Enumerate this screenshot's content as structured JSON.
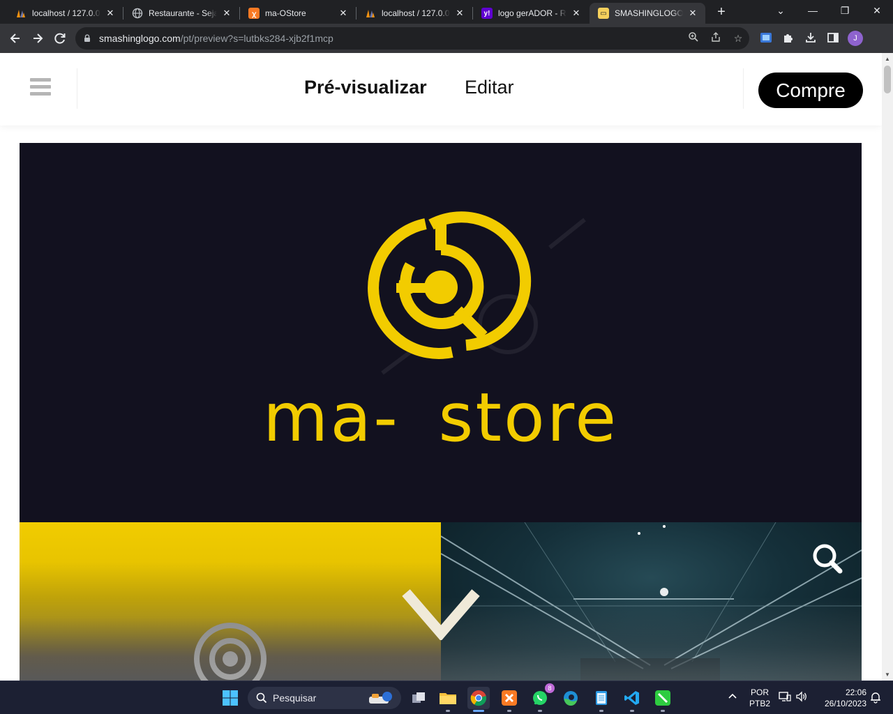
{
  "browser": {
    "tabs": [
      {
        "title": "localhost / 127.0.0.",
        "icon": "phpmyadmin-icon",
        "active": false
      },
      {
        "title": "Restaurante - Seja",
        "icon": "globe-icon",
        "active": false
      },
      {
        "title": "ma-OStore",
        "icon": "xampp-icon",
        "active": false
      },
      {
        "title": "localhost / 127.0.0.",
        "icon": "phpmyadmin-icon",
        "active": false
      },
      {
        "title": "logo gerADOR - Re",
        "icon": "yahoo-icon",
        "active": false
      },
      {
        "title": "SMASHINGLOGO |",
        "icon": "smashinglogo-icon",
        "active": true
      }
    ],
    "new_tab": "+",
    "window_controls": {
      "dropdown": "⌄",
      "minimize": "—",
      "restore": "❐",
      "close": "✕"
    },
    "url": {
      "host": "smashinglogo.com",
      "path": "/pt/preview?s=lutbks284-xjb2f1mcp"
    },
    "profile_initial": "J"
  },
  "site": {
    "nav": {
      "preview_label": "Pré-visualizar",
      "edit_label": "Editar",
      "buy_label": "Compre"
    },
    "logo_text": "ma- store",
    "colors": {
      "brand_yellow": "#F2CC00",
      "preview_bg": "#12111F"
    }
  },
  "taskbar": {
    "search_label": "Pesquisar",
    "whatsapp_badge": "8",
    "language": {
      "line1": "POR",
      "line2": "PTB2"
    },
    "time": "22:06",
    "date": "26/10/2023"
  }
}
